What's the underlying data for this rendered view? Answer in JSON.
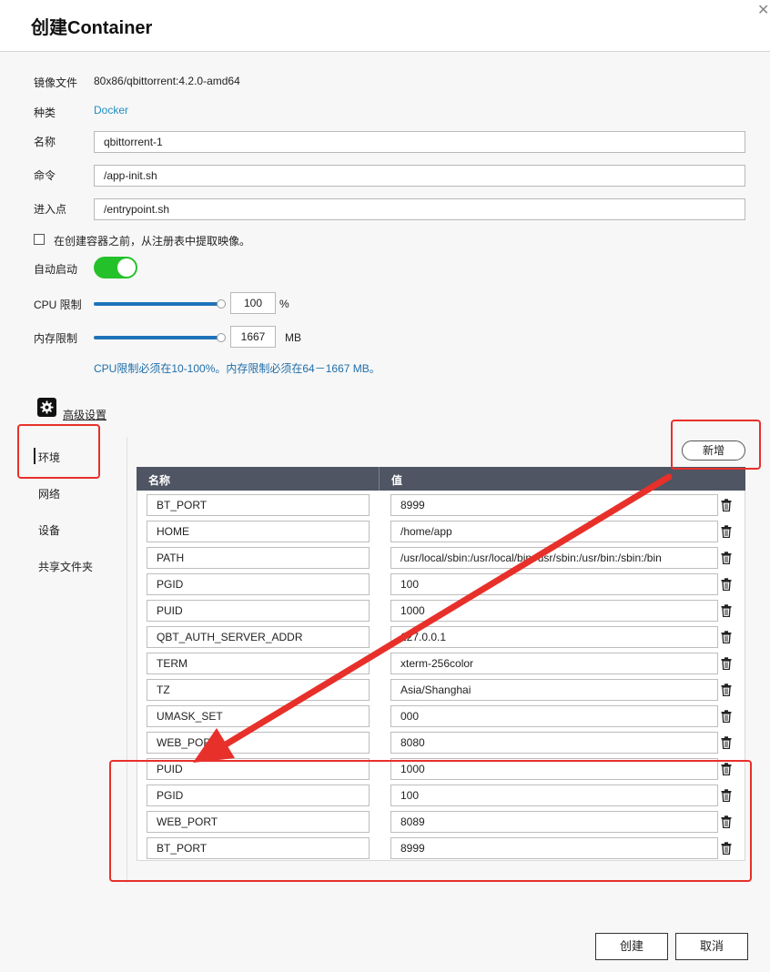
{
  "dialog": {
    "title": "创建Container",
    "close_icon": "close-icon"
  },
  "form": {
    "image_label": "镜像文件",
    "image_value": "80x86/qbittorrent:4.2.0-amd64",
    "type_label": "种类",
    "type_value": "Docker",
    "name_label": "名称",
    "name_value": "qbittorrent-1",
    "command_label": "命令",
    "command_value": "/app-init.sh",
    "entrypoint_label": "进入点",
    "entrypoint_value": "/entrypoint.sh",
    "pull_checkbox_label": "在创建容器之前，从注册表中提取映像。",
    "pull_checkbox_checked": false,
    "autostart_label": "自动启动",
    "autostart_on": true,
    "cpu_label": "CPU 限制",
    "cpu_value": "100",
    "cpu_unit": "%",
    "cpu_slider_fraction": 1.0,
    "mem_label": "内存限制",
    "mem_value": "1667",
    "mem_unit": "MB",
    "mem_slider_fraction": 1.0,
    "limit_hint": "CPU限制必须在10-100%。内存限制必须在64－1667 MB。"
  },
  "advanced": {
    "label": "高级设置",
    "icon": "gear-icon"
  },
  "sidebar": {
    "items": [
      {
        "label": "环境",
        "active": true
      },
      {
        "label": "网络",
        "active": false
      },
      {
        "label": "设备",
        "active": false
      },
      {
        "label": "共享文件夹",
        "active": false
      }
    ]
  },
  "env": {
    "add_button": "新增",
    "col_name": "名称",
    "col_value": "值",
    "rows": [
      {
        "name": "BT_PORT",
        "value": "8999"
      },
      {
        "name": "HOME",
        "value": "/home/app"
      },
      {
        "name": "PATH",
        "value": "/usr/local/sbin:/usr/local/bin:/usr/sbin:/usr/bin:/sbin:/bin"
      },
      {
        "name": "PGID",
        "value": "100"
      },
      {
        "name": "PUID",
        "value": "1000"
      },
      {
        "name": "QBT_AUTH_SERVER_ADDR",
        "value": "127.0.0.1"
      },
      {
        "name": "TERM",
        "value": "xterm-256color"
      },
      {
        "name": "TZ",
        "value": "Asia/Shanghai"
      },
      {
        "name": "UMASK_SET",
        "value": "000"
      },
      {
        "name": "WEB_PORT",
        "value": "8080"
      },
      {
        "name": "PUID",
        "value": "1000"
      },
      {
        "name": "PGID",
        "value": "100"
      },
      {
        "name": "WEB_PORT",
        "value": "8089"
      },
      {
        "name": "BT_PORT",
        "value": "8999"
      }
    ],
    "delete_icon": "trash-icon"
  },
  "footer": {
    "create_button": "创建",
    "cancel_button": "取消"
  },
  "annotations": {
    "color": "#e8302a",
    "arrow_icon": "red-arrow"
  }
}
